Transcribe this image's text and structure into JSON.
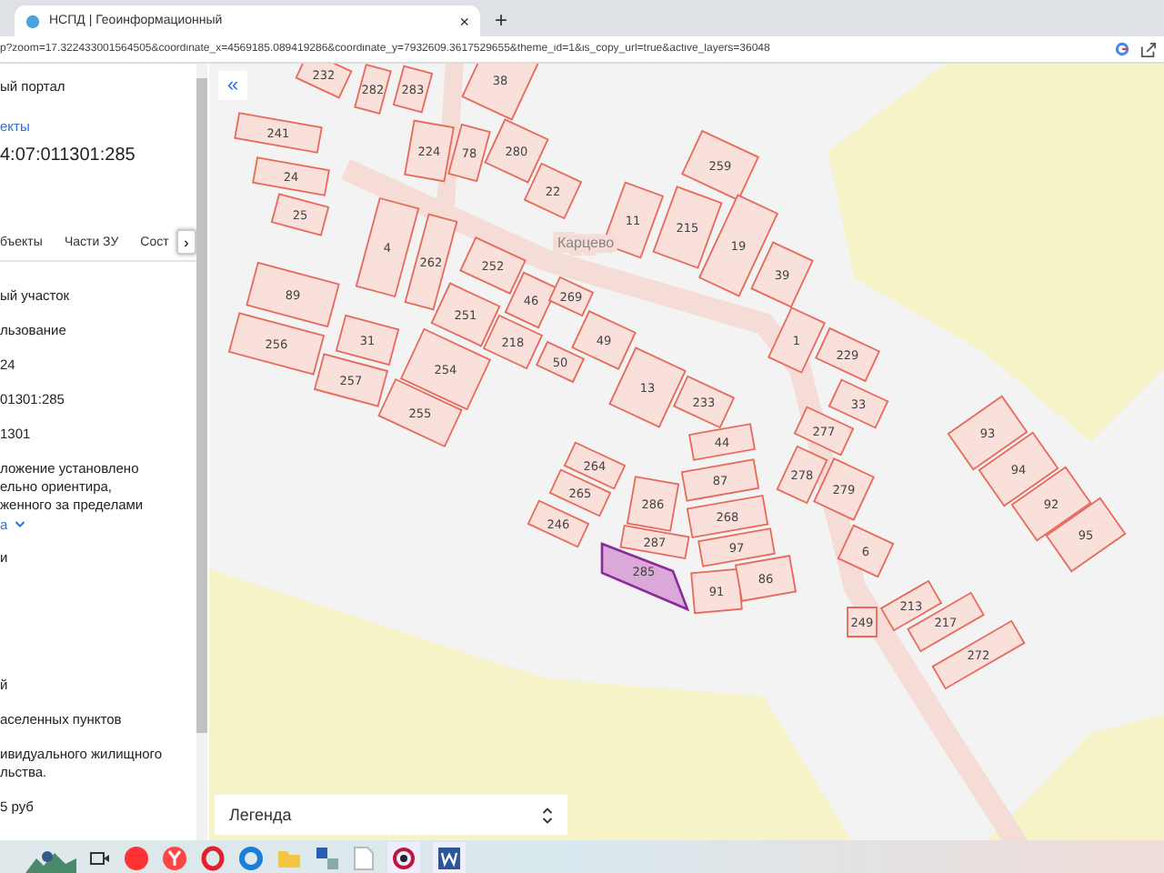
{
  "browser": {
    "tab_title": "НСПД | Геоинформационный",
    "tab_close": "×",
    "new_tab": "+",
    "address": "p?zoom=17.322433001564505&coordinate_x=4569185.089419286&coordinate_y=7932609.3617529655&theme_id=1&is_copy_url=true&active_layers=36048"
  },
  "panel": {
    "portal": "ый портал",
    "link": "екты",
    "cadastral_number": "4:07:011301:285",
    "tabs": [
      {
        "label": "бъекты",
        "selected": false
      },
      {
        "label": "Части ЗУ",
        "selected": false
      },
      {
        "label": "Сост",
        "selected": false
      }
    ],
    "more_button": "›",
    "fields": [
      {
        "kind": "text",
        "lines": [
          "ый участок"
        ]
      },
      {
        "kind": "text",
        "lines": [
          "льзование"
        ]
      },
      {
        "kind": "text",
        "lines": [
          "24"
        ]
      },
      {
        "kind": "text",
        "lines": [
          "01301:285"
        ]
      },
      {
        "kind": "text",
        "lines": [
          "1301"
        ]
      },
      {
        "kind": "text",
        "lines": [
          "ложение установлено",
          "ельно ориентира,",
          "женного за пределами"
        ]
      },
      {
        "kind": "link",
        "lines": [
          "а"
        ]
      },
      {
        "kind": "text",
        "lines": [
          "и"
        ]
      },
      {
        "kind": "spacer"
      },
      {
        "kind": "text",
        "lines": [
          "й"
        ]
      },
      {
        "kind": "text",
        "lines": [
          "аселенных пунктов"
        ]
      },
      {
        "kind": "text",
        "lines": [
          "ивидуального жилищного",
          "льства."
        ]
      },
      {
        "kind": "text",
        "lines": [
          "5 руб"
        ]
      }
    ]
  },
  "map": {
    "collapse_button": "«",
    "street_label": "Карцево",
    "parcels": [
      {
        "label": "232",
        "selected": false
      },
      {
        "label": "282",
        "selected": false
      },
      {
        "label": "283",
        "selected": false
      },
      {
        "label": "38",
        "selected": false
      },
      {
        "label": "241",
        "selected": false
      },
      {
        "label": "224",
        "selected": false
      },
      {
        "label": "78",
        "selected": false
      },
      {
        "label": "280",
        "selected": false
      },
      {
        "label": "22",
        "selected": false
      },
      {
        "label": "24",
        "selected": false
      },
      {
        "label": "25",
        "selected": false
      },
      {
        "label": "259",
        "selected": false
      },
      {
        "label": "11",
        "selected": false
      },
      {
        "label": "215",
        "selected": false
      },
      {
        "label": "19",
        "selected": false
      },
      {
        "label": "39",
        "selected": false
      },
      {
        "label": "4",
        "selected": false
      },
      {
        "label": "262",
        "selected": false
      },
      {
        "label": "252",
        "selected": false
      },
      {
        "label": "46",
        "selected": false
      },
      {
        "label": "269",
        "selected": false
      },
      {
        "label": "49",
        "selected": false
      },
      {
        "label": "89",
        "selected": false
      },
      {
        "label": "256",
        "selected": false
      },
      {
        "label": "31",
        "selected": false
      },
      {
        "label": "251",
        "selected": false
      },
      {
        "label": "218",
        "selected": false
      },
      {
        "label": "50",
        "selected": false
      },
      {
        "label": "257",
        "selected": false
      },
      {
        "label": "254",
        "selected": false
      },
      {
        "label": "13",
        "selected": false
      },
      {
        "label": "255",
        "selected": false
      },
      {
        "label": "233",
        "selected": false
      },
      {
        "label": "1",
        "selected": false
      },
      {
        "label": "229",
        "selected": false
      },
      {
        "label": "33",
        "selected": false
      },
      {
        "label": "44",
        "selected": false
      },
      {
        "label": "277",
        "selected": false
      },
      {
        "label": "93",
        "selected": false
      },
      {
        "label": "264",
        "selected": false
      },
      {
        "label": "87",
        "selected": false
      },
      {
        "label": "278",
        "selected": false
      },
      {
        "label": "94",
        "selected": false
      },
      {
        "label": "265",
        "selected": false
      },
      {
        "label": "286",
        "selected": false
      },
      {
        "label": "268",
        "selected": false
      },
      {
        "label": "279",
        "selected": false
      },
      {
        "label": "92",
        "selected": false
      },
      {
        "label": "246",
        "selected": false
      },
      {
        "label": "287",
        "selected": false
      },
      {
        "label": "97",
        "selected": false
      },
      {
        "label": "6",
        "selected": false
      },
      {
        "label": "95",
        "selected": false
      },
      {
        "label": "285",
        "selected": true
      },
      {
        "label": "91",
        "selected": false
      },
      {
        "label": "86",
        "selected": false
      },
      {
        "label": "249",
        "selected": false
      },
      {
        "label": "213",
        "selected": false
      },
      {
        "label": "217",
        "selected": false
      },
      {
        "label": "272",
        "selected": false
      }
    ],
    "legend": {
      "label": "Легенда"
    }
  }
}
